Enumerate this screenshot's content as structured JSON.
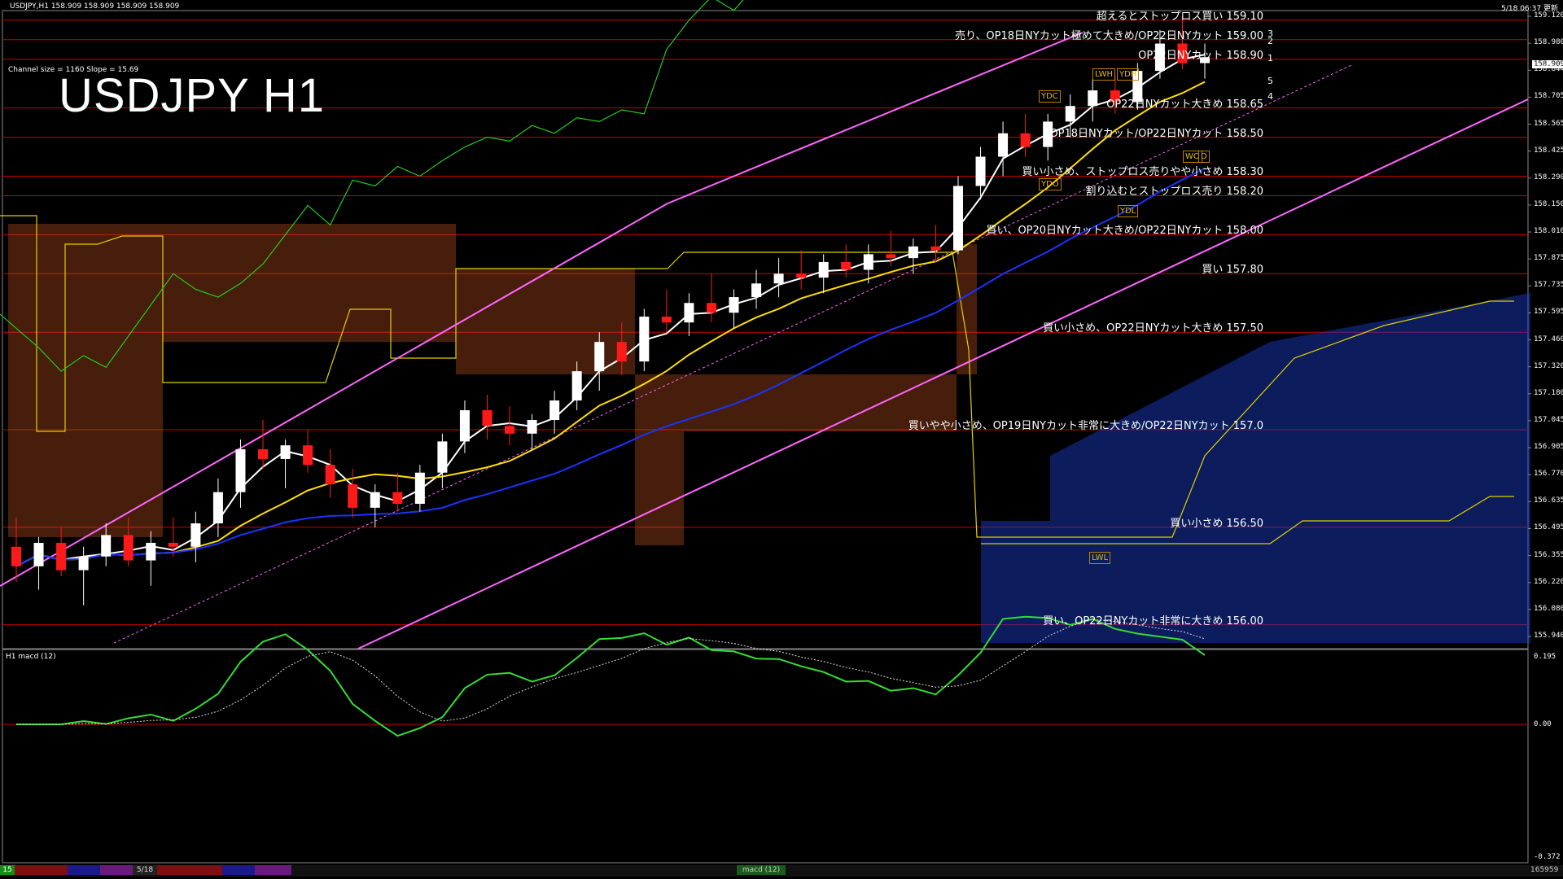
{
  "header": {
    "symbol_info": "USDJPY,H1  158.909 158.909 158.909 158.909",
    "server_time": "5/18 06:37 更新",
    "channel_info": "Channel size = 1160 Slope = 15.69",
    "big_title": "USDJPY H1"
  },
  "colors": {
    "background": "#000000",
    "level_line": "#cc0000",
    "channel": "#ff66ff",
    "ichimoku_cloud_bull": "#cc5522",
    "ichimoku_cloud_bear": "#1a3fcc",
    "ma_white": "#ffffff",
    "ma_yellow": "#ffdd00",
    "ma_blue": "#1a33ff",
    "chikou_green": "#22cc22",
    "bull_candle": "#ffffff",
    "bear_candle": "#ff1a1a",
    "macd_green": "#33dd33",
    "macd_pink": "#ee88aa"
  },
  "chart_data": {
    "type": "candlestick",
    "symbol": "USDJPY",
    "timeframe": "H1",
    "current_price": "158.909",
    "y_ticks": [
      "159.120",
      "158.980",
      "158.844",
      "158.705",
      "158.565",
      "158.425",
      "158.290",
      "158.150",
      "158.010",
      "157.875",
      "157.735",
      "157.595",
      "157.460",
      "157.320",
      "157.180",
      "157.045",
      "156.905",
      "156.770",
      "156.635",
      "156.495",
      "156.355",
      "156.220",
      "156.080",
      "155.940"
    ],
    "ylim": [
      155.94,
      159.12
    ],
    "levels": [
      {
        "price": 159.1,
        "text": "超えるとストップロス買い 159.10"
      },
      {
        "price": 159.0,
        "text": "売り、OP18日NYカット極めて大きめ/OP22日NYカット 159.00"
      },
      {
        "price": 158.9,
        "text": "OP22日NYカット 158.90"
      },
      {
        "price": 158.65,
        "text": "OP22日NYカット大きめ 158.65"
      },
      {
        "price": 158.5,
        "text": "OP18日NYカット/OP22日NYカット 158.50"
      },
      {
        "price": 158.3,
        "text": "買い小さめ、ストップロス売りやや小さめ 158.30"
      },
      {
        "price": 158.2,
        "text": "割り込むとストップロス売り 158.20"
      },
      {
        "price": 158.0,
        "text": "買い、OP20日NYカット大きめ/OP22日NYカット 158.00"
      },
      {
        "price": 157.8,
        "text": "買い 157.80"
      },
      {
        "price": 157.5,
        "text": "買い小さめ、OP22日NYカット大きめ 157.50"
      },
      {
        "price": 157.0,
        "text": "買いやや小さめ、OP19日NYカット非常に大きめ/OP22日NYカット 157.0"
      },
      {
        "price": 156.5,
        "text": "買い小さめ 156.50"
      },
      {
        "price": 156.0,
        "text": "買い、OP22日NYカット非常に大きめ 156.00"
      }
    ],
    "box_labels": [
      "LWH",
      "YDH",
      "YDC",
      "YDO",
      "YDL",
      "LWL",
      "WO",
      "D"
    ],
    "number_labels": [
      "3",
      "2",
      "1",
      "5",
      "4"
    ],
    "candles": [
      {
        "o": 156.4,
        "h": 156.55,
        "l": 156.22,
        "c": 156.3
      },
      {
        "o": 156.3,
        "h": 156.45,
        "l": 156.18,
        "c": 156.42
      },
      {
        "o": 156.42,
        "h": 156.5,
        "l": 156.25,
        "c": 156.28
      },
      {
        "o": 156.28,
        "h": 156.4,
        "l": 156.1,
        "c": 156.35
      },
      {
        "o": 156.35,
        "h": 156.52,
        "l": 156.3,
        "c": 156.46
      },
      {
        "o": 156.46,
        "h": 156.55,
        "l": 156.3,
        "c": 156.33
      },
      {
        "o": 156.33,
        "h": 156.48,
        "l": 156.2,
        "c": 156.42
      },
      {
        "o": 156.42,
        "h": 156.55,
        "l": 156.35,
        "c": 156.4
      },
      {
        "o": 156.4,
        "h": 156.58,
        "l": 156.32,
        "c": 156.52
      },
      {
        "o": 156.52,
        "h": 156.75,
        "l": 156.45,
        "c": 156.68
      },
      {
        "o": 156.68,
        "h": 156.95,
        "l": 156.6,
        "c": 156.9
      },
      {
        "o": 156.9,
        "h": 157.05,
        "l": 156.8,
        "c": 156.85
      },
      {
        "o": 156.85,
        "h": 156.95,
        "l": 156.7,
        "c": 156.92
      },
      {
        "o": 156.92,
        "h": 157.0,
        "l": 156.78,
        "c": 156.82
      },
      {
        "o": 156.82,
        "h": 156.9,
        "l": 156.65,
        "c": 156.72
      },
      {
        "o": 156.72,
        "h": 156.8,
        "l": 156.55,
        "c": 156.6
      },
      {
        "o": 156.6,
        "h": 156.72,
        "l": 156.5,
        "c": 156.68
      },
      {
        "o": 156.68,
        "h": 156.78,
        "l": 156.58,
        "c": 156.62
      },
      {
        "o": 156.62,
        "h": 156.82,
        "l": 156.58,
        "c": 156.78
      },
      {
        "o": 156.78,
        "h": 156.98,
        "l": 156.7,
        "c": 156.94
      },
      {
        "o": 156.94,
        "h": 157.15,
        "l": 156.88,
        "c": 157.1
      },
      {
        "o": 157.1,
        "h": 157.18,
        "l": 156.95,
        "c": 157.02
      },
      {
        "o": 157.02,
        "h": 157.12,
        "l": 156.92,
        "c": 156.98
      },
      {
        "o": 156.98,
        "h": 157.08,
        "l": 156.9,
        "c": 157.05
      },
      {
        "o": 157.05,
        "h": 157.2,
        "l": 156.98,
        "c": 157.15
      },
      {
        "o": 157.15,
        "h": 157.35,
        "l": 157.1,
        "c": 157.3
      },
      {
        "o": 157.3,
        "h": 157.5,
        "l": 157.2,
        "c": 157.45
      },
      {
        "o": 157.45,
        "h": 157.55,
        "l": 157.28,
        "c": 157.35
      },
      {
        "o": 157.35,
        "h": 157.62,
        "l": 157.3,
        "c": 157.58
      },
      {
        "o": 157.58,
        "h": 157.72,
        "l": 157.5,
        "c": 157.55
      },
      {
        "o": 157.55,
        "h": 157.7,
        "l": 157.48,
        "c": 157.65
      },
      {
        "o": 157.65,
        "h": 157.8,
        "l": 157.55,
        "c": 157.6
      },
      {
        "o": 157.6,
        "h": 157.72,
        "l": 157.52,
        "c": 157.68
      },
      {
        "o": 157.68,
        "h": 157.82,
        "l": 157.62,
        "c": 157.75
      },
      {
        "o": 157.75,
        "h": 157.88,
        "l": 157.68,
        "c": 157.8
      },
      {
        "o": 157.8,
        "h": 157.92,
        "l": 157.72,
        "c": 157.78
      },
      {
        "o": 157.78,
        "h": 157.9,
        "l": 157.7,
        "c": 157.86
      },
      {
        "o": 157.86,
        "h": 157.95,
        "l": 157.78,
        "c": 157.82
      },
      {
        "o": 157.82,
        "h": 157.95,
        "l": 157.75,
        "c": 157.9
      },
      {
        "o": 157.9,
        "h": 158.02,
        "l": 157.84,
        "c": 157.88
      },
      {
        "o": 157.88,
        "h": 157.98,
        "l": 157.8,
        "c": 157.94
      },
      {
        "o": 157.94,
        "h": 158.05,
        "l": 157.86,
        "c": 157.92
      },
      {
        "o": 157.92,
        "h": 158.3,
        "l": 157.9,
        "c": 158.25
      },
      {
        "o": 158.25,
        "h": 158.45,
        "l": 158.18,
        "c": 158.4
      },
      {
        "o": 158.4,
        "h": 158.58,
        "l": 158.3,
        "c": 158.52
      },
      {
        "o": 158.52,
        "h": 158.62,
        "l": 158.4,
        "c": 158.45
      },
      {
        "o": 158.45,
        "h": 158.62,
        "l": 158.38,
        "c": 158.58
      },
      {
        "o": 158.58,
        "h": 158.72,
        "l": 158.5,
        "c": 158.66
      },
      {
        "o": 158.66,
        "h": 158.8,
        "l": 158.58,
        "c": 158.74
      },
      {
        "o": 158.74,
        "h": 158.82,
        "l": 158.62,
        "c": 158.68
      },
      {
        "o": 158.68,
        "h": 158.88,
        "l": 158.64,
        "c": 158.84
      },
      {
        "o": 158.84,
        "h": 159.05,
        "l": 158.8,
        "c": 158.98
      },
      {
        "o": 158.98,
        "h": 159.12,
        "l": 158.85,
        "c": 158.88
      },
      {
        "o": 158.88,
        "h": 158.98,
        "l": 158.8,
        "c": 158.91
      }
    ]
  },
  "macd_panel": {
    "label": "H1 macd (12)",
    "ticks": [
      "0.195",
      "0.00",
      "-0.372"
    ]
  },
  "bottom_bar": {
    "left_label": "15",
    "date_label": "5/18",
    "macd_label": "macd (12)",
    "right_label": "165959"
  }
}
